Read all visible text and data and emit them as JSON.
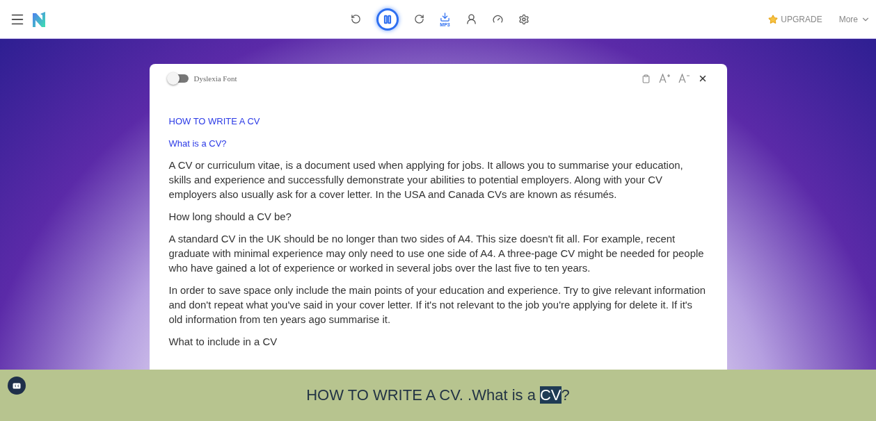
{
  "player": {
    "playing": true,
    "download_label": "MP3"
  },
  "header_right": {
    "upgrade": "UPGRADE",
    "more": "More"
  },
  "reader": {
    "dyslexia_toggle": {
      "label": "Dyslexia Font",
      "on": false
    },
    "blocks": [
      {
        "kind": "title",
        "text": "HOW TO WRITE A CV"
      },
      {
        "kind": "subtitle",
        "text": "What is a CV?"
      },
      {
        "kind": "paragraph",
        "text": "A CV or curriculum vitae, is a document used when applying for jobs. It allows you to summarise your education, skills and experience and successfully demonstrate your abilities to potential employers. Along with your CV employers also usually ask for a cover letter. In the USA and Canada CVs are known as résumés."
      },
      {
        "kind": "paragraph",
        "text": "How long should a CV be?"
      },
      {
        "kind": "paragraph",
        "text": "A standard CV in the UK should be no longer than two sides of A4. This size doesn't fit all. For example, recent graduate with minimal experience may only need to use one side of A4. A three-page CV might be needed for people who have gained a lot of experience or worked in several jobs over the last five to ten years."
      },
      {
        "kind": "paragraph",
        "text": "In order to save space only include the main points of your education and experience. Try to give relevant information and don't repeat what you've said in your cover letter. If it's not relevant to the job you're applying for delete it. If it's old information from ten years ago summarise it."
      },
      {
        "kind": "paragraph",
        "text": "What to include in a CV"
      }
    ]
  },
  "caption": {
    "segments": [
      {
        "text": "HOW TO WRITE A CV. .What is a ",
        "highlighted": false
      },
      {
        "text": "CV",
        "highlighted": true
      },
      {
        "text": "?",
        "highlighted": false
      }
    ]
  }
}
